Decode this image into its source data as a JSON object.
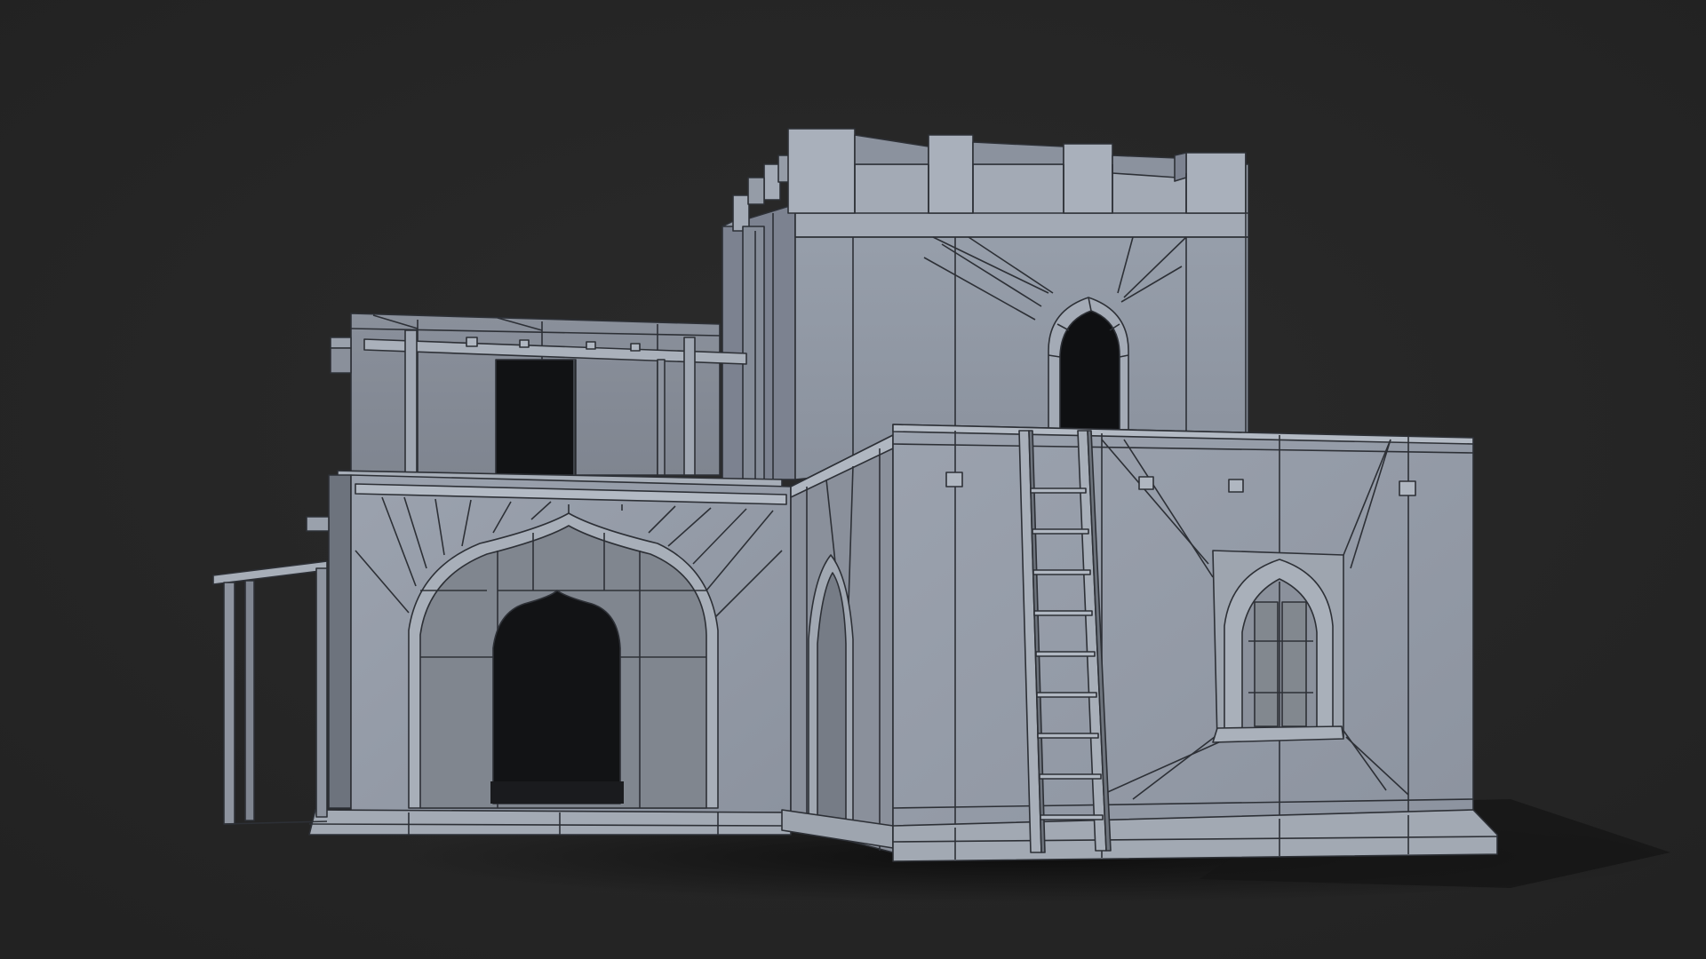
{
  "colors": {
    "background": "#262626",
    "wall_lit": "#9aa0ac",
    "wall_mid": "#8a909b",
    "wall_shade": "#6f7580",
    "wall_dark": "#55595f",
    "opening": "#0f1012",
    "wire": "#2d3036",
    "shadow": "#101010"
  }
}
